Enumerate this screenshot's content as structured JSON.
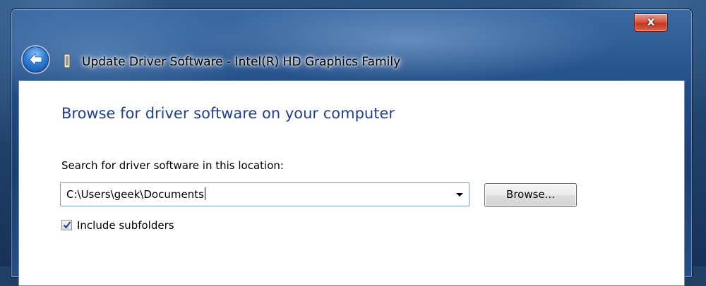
{
  "window": {
    "title": "Update Driver Software - Intel(R) HD Graphics Family",
    "close_label": "x"
  },
  "dialog": {
    "heading": "Browse for driver software on your computer",
    "location_label": "Search for driver software in this location:",
    "path_value": "C:\\Users\\geek\\Documents",
    "browse_label": "Browse...",
    "include_subfolders_label": "Include subfolders",
    "include_subfolders_checked": true
  },
  "icons": {
    "back": "back-arrow-icon",
    "device": "device-icon",
    "dropdown": "chevron-down-icon",
    "checkmark": "checkmark-icon"
  },
  "colors": {
    "heading": "#1e3f9a",
    "titlebar": "#224d86",
    "close_button": "#c23a20"
  }
}
